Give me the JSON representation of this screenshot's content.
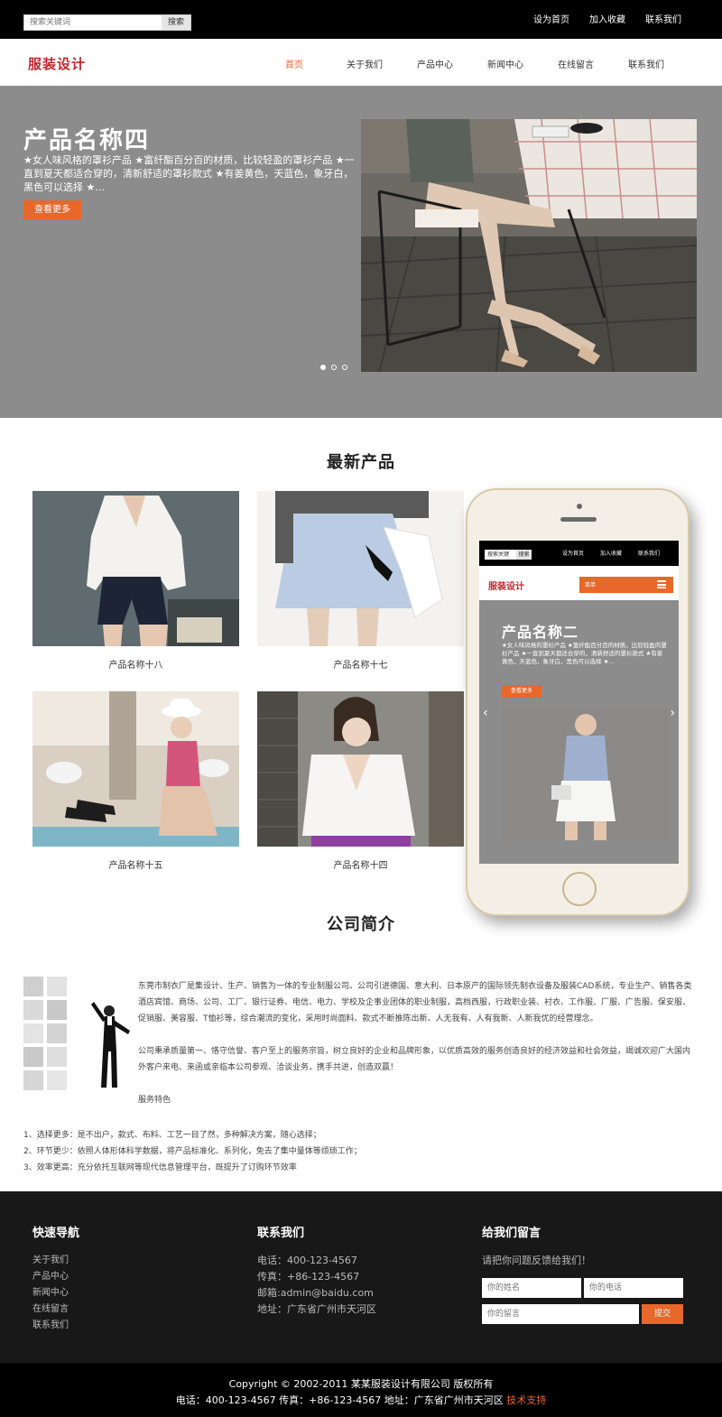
{
  "topbar": {
    "search_placeholder": "搜索关键词",
    "search_button": "搜索",
    "links": [
      "设为首页",
      "加入收藏",
      "联系我们"
    ]
  },
  "header": {
    "logo": "服装设计",
    "nav": [
      "首页",
      "关于我们",
      "产品中心",
      "新闻中心",
      "在线留言",
      "联系我们"
    ],
    "active_nav": "首页"
  },
  "banner": {
    "title": "产品名称四",
    "desc": "★女人味风格的罩衫产品 ★富纤酯百分百的材质，比较轻盈的罩衫产品 ★一直到夏天都适合穿的，清新舒适的罩衫款式 ★有姜黄色，天蓝色，象牙白，黑色可以选择 ★...",
    "button": "查看更多",
    "slide_count": 3,
    "active_slide": 1
  },
  "products": {
    "title": "最新产品",
    "items": [
      {
        "name": "产品名称十八"
      },
      {
        "name": "产品名称十七"
      },
      {
        "name": "产品名称十五"
      },
      {
        "name": "产品名称十四"
      }
    ]
  },
  "phone": {
    "search_placeholder": "搜索关键",
    "search_button": "搜索",
    "links": [
      "设为首页",
      "加入收藏",
      "联系我们"
    ],
    "logo": "服装设计",
    "menu_label": "菜单",
    "banner_title": "产品名称二",
    "banner_desc": "★女人味风格的罩衫产品 ★富纤酯百分百的材质，比较轻盈的罩衫产品 ★一直到夏天都适合穿的，清新舒适的罩衫款式 ★有姜黄色，天蓝色，象牙白，黑色可以选择 ★...",
    "banner_button": "查看更多"
  },
  "about": {
    "title": "公司简介",
    "p1": "东莞市制衣厂是集设计、生产、销售为一体的专业制服公司。公司引进德国、意大利、日本原产的国际领先制衣设备及服装CAD系统，专业生产、销售各类酒店宾馆、商场、公司、工厂、银行证券、电信、电力、学校及企事业团体的职业制服，高档西服，行政职业装、衬衣、工作服、厂服、广告服、保安服、促销服、美容服、T恤衫等，综合潮流的变化，采用时尚面料、款式不断推陈出新、人无我有、人有我新、人新我优的经营理念。",
    "p2": "公司秉承质量第一、恪守信誉、客户至上的服务宗旨，树立良好的企业和品牌形象，以优质高效的服务创造良好的经济效益和社会效益，竭诚欢迎广大国内外客户来电、来函或亲临本公司参观、洽谈业务，携手共进，创造双赢！",
    "p3": "服务特色",
    "features": [
      "1、选择更多：是不出户，款式、布料、工艺一目了然，多种解决方案，随心选择；",
      "2、环节更少：依照人体形体科学数据，将产品标准化、系列化，免去了集中量体等烦琐工作；",
      "3、效率更高：充分依托互联网等现代信息管理平台，既提升了订购环节效率"
    ]
  },
  "footer": {
    "nav_title": "快速导航",
    "nav_links": [
      "关于我们",
      "产品中心",
      "新闻中心",
      "在线留言",
      "联系我们"
    ],
    "contact_title": "联系我们",
    "contact": {
      "phone": "电话：400-123-4567",
      "fax": "传真：+86-123-4567",
      "email": "邮箱:admin@baidu.com",
      "address": "地址：广东省广州市天河区"
    },
    "msg_title": "给我们留言",
    "msg_subtitle": "请把你问题反馈给我们！",
    "name_placeholder": "你的姓名",
    "phone_placeholder": "你的电话",
    "message_placeholder": "你的留言",
    "submit": "提交"
  },
  "copyright": {
    "line1": "Copyright © 2002-2011 某某服装设计有限公司 版权所有",
    "line2": "电话：400-123-4567 传真：+86-123-4567 地址：广东省广州市天河区",
    "tech": "技术支持"
  },
  "colors": {
    "accent": "#e8672b",
    "logo": "#c0282d",
    "banner_bg": "#8c8c8c",
    "footer_bg": "#181818"
  }
}
